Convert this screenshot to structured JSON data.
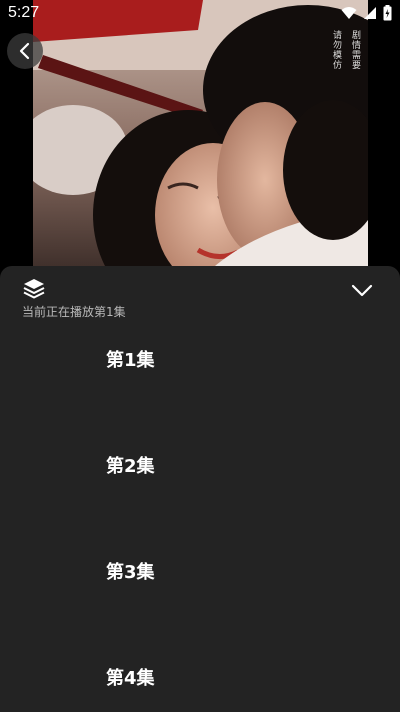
{
  "status_bar": {
    "time": "5:27"
  },
  "video": {
    "watermark_lines": [
      "剧情需要",
      "请勿模仿"
    ]
  },
  "sheet": {
    "subtitle": "当前正在播放第1集",
    "episodes": [
      {
        "label": "第1集"
      },
      {
        "label": "第2集"
      },
      {
        "label": "第3集"
      },
      {
        "label": "第4集"
      }
    ]
  },
  "icons": {
    "back": "chevron-left-icon",
    "collapse": "chevron-down-icon",
    "layers": "layers-icon",
    "wifi": "wifi-icon",
    "signal": "signal-icon",
    "battery": "battery-icon"
  }
}
